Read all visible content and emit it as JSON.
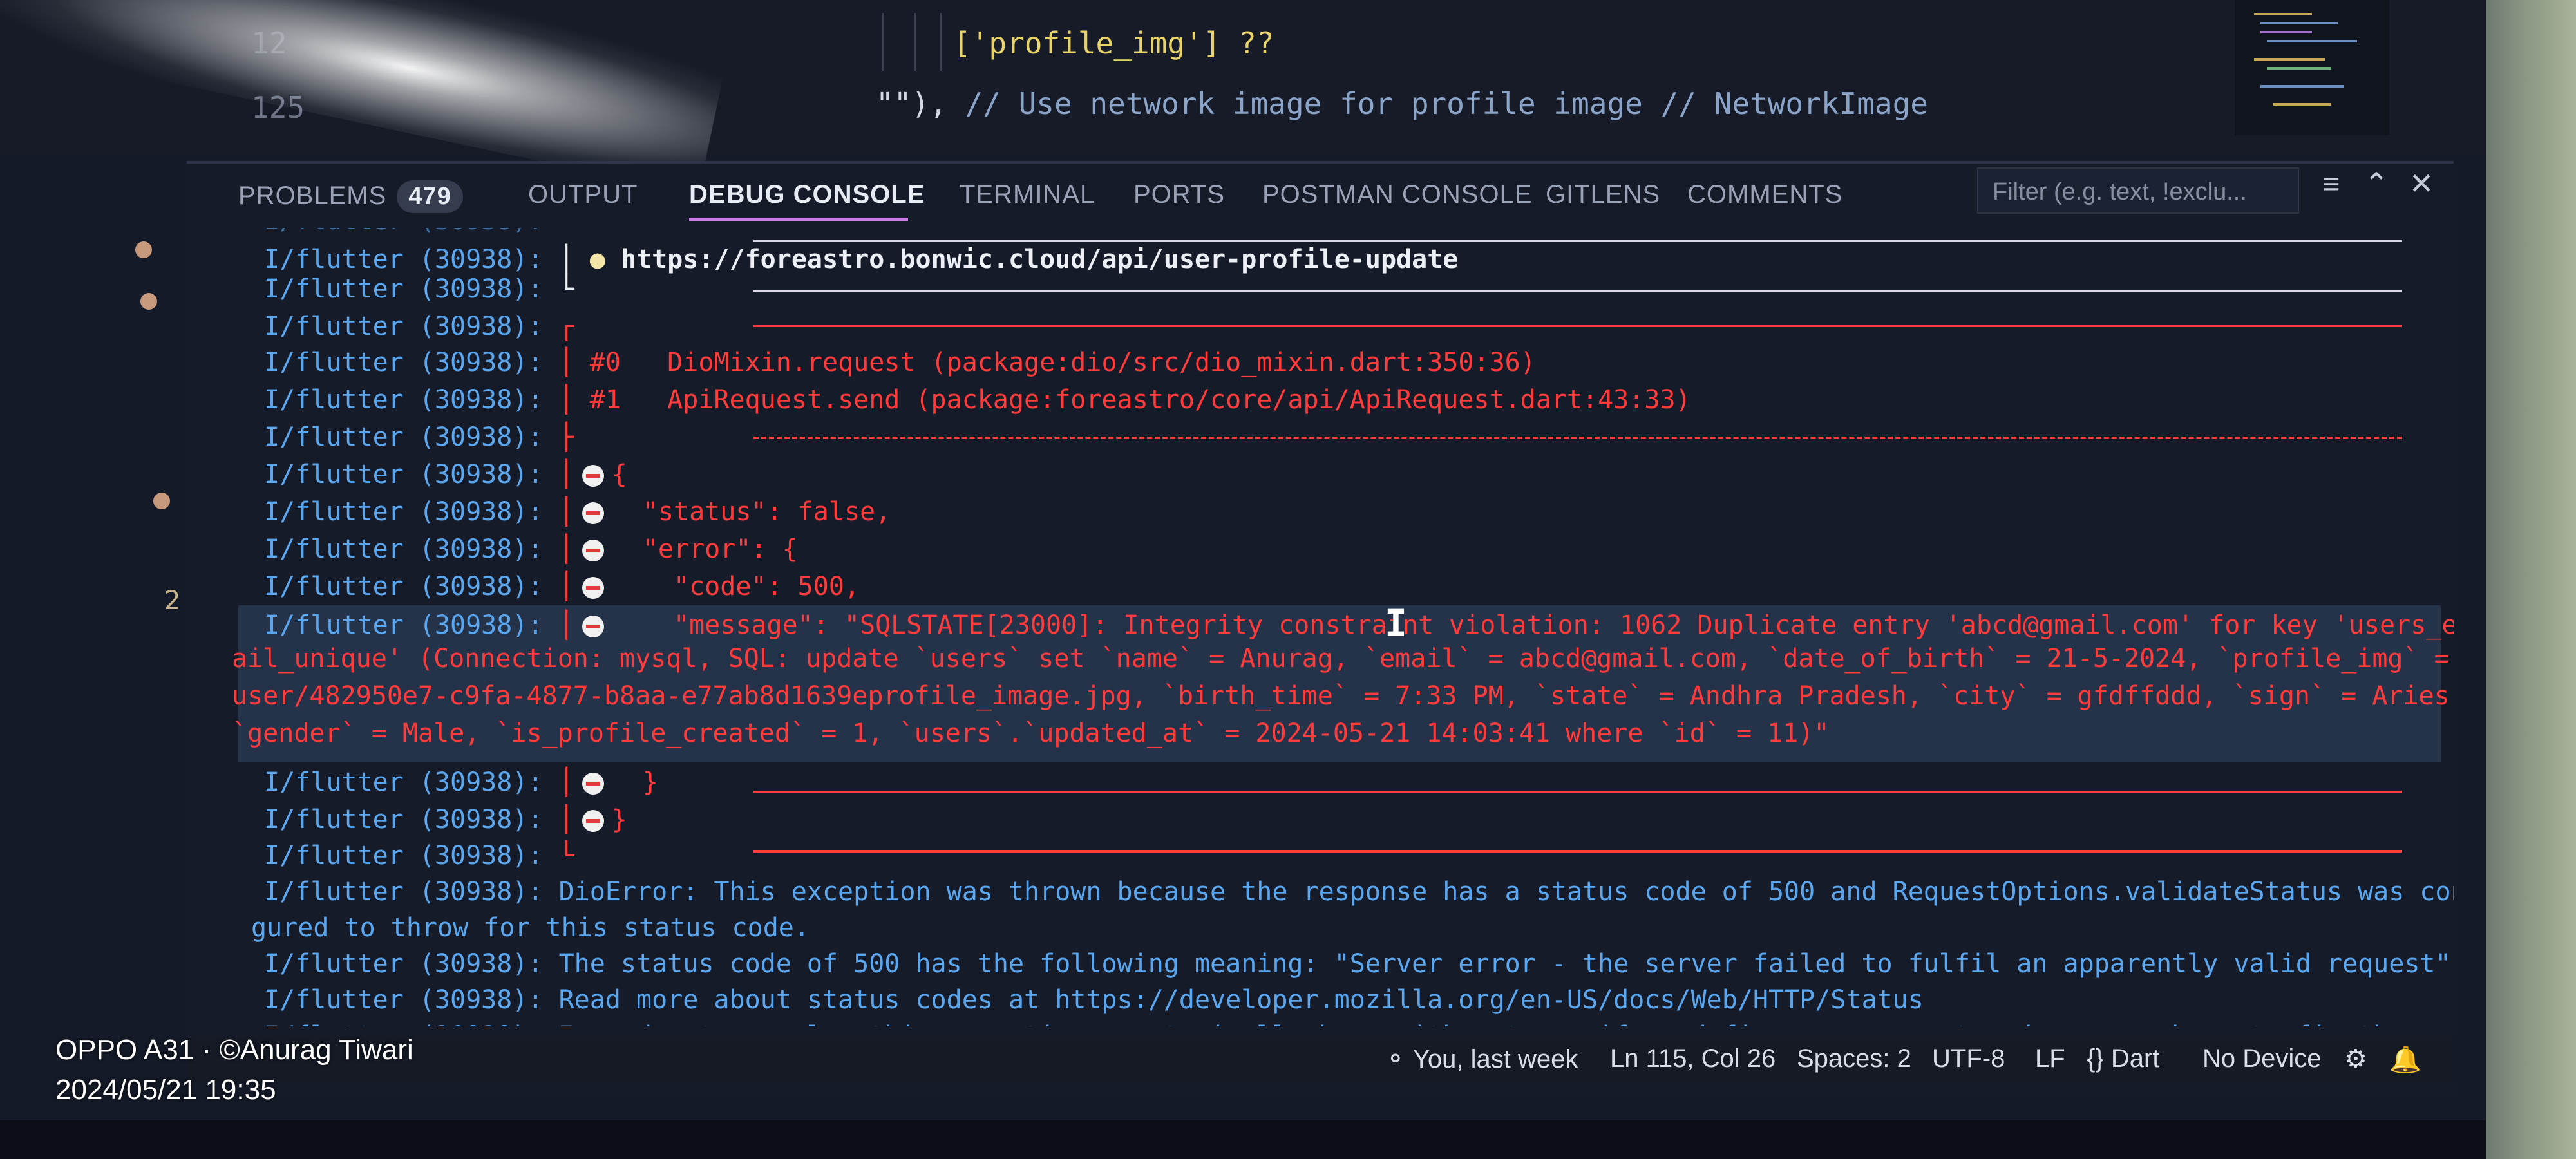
{
  "editor": {
    "line_numbers": [
      "12",
      "125"
    ],
    "code_line_1": "['profile_img'] ??",
    "code_line_2_code": "\"\"), ",
    "code_line_2_comment": "// Use network image for profile image // NetworkImage"
  },
  "sidebar": {
    "badge": "2"
  },
  "panel": {
    "tabs": [
      {
        "label": "PROBLEMS",
        "badge": "479"
      },
      {
        "label": "OUTPUT"
      },
      {
        "label": "DEBUG CONSOLE",
        "active": true
      },
      {
        "label": "TERMINAL"
      },
      {
        "label": "PORTS"
      },
      {
        "label": "POSTMAN CONSOLE"
      },
      {
        "label": "GITLENS"
      },
      {
        "label": "COMMENTS"
      }
    ],
    "filter_placeholder": "Filter (e.g. text, !exclu...",
    "icons": [
      "list-filter-icon",
      "chevron-up-icon",
      "close-icon"
    ]
  },
  "console": {
    "prefix": "I/flutter (30938):",
    "truncated_top": "I/flutter (30938):",
    "url": "https://foreastro.bonwic.cloud/api/user-profile-update",
    "stack_0": "#0   DioMixin.request (package:dio/src/dio_mixin.dart:350:36)",
    "stack_1": "#1   ApiRequest.send (package:foreastro/core/api/ApiRequest.dart:43:33)",
    "json_open": "{",
    "status_line": "\"status\": false,",
    "error_line": "\"error\": {",
    "code_line": "\"code\": 500,",
    "message_line": "\"message\": \"SQLSTATE[23000]: Integrity constraint violation: 1062 Duplicate entry 'abcd@gmail.com' for key 'users_em",
    "message_wrap_1": "ail_unique' (Connection: mysql, SQL: update `users` set `name` = Anurag, `email` = abcd@gmail.com, `date_of_birth` = 21-5-2024, `profile_img` =",
    "message_wrap_2": "user/482950e7-c9fa-4877-b8aa-e77ab8d1639eprofile_image.jpg, `birth_time` = 7:33 PM, `state` = Andhra Pradesh, `city` = gfdffddd, `sign` = Aries,",
    "message_wrap_3": "`gender` = Male, `is_profile_created` = 1, `users`.`updated_at` = 2024-05-21 14:03:41 where `id` = 11)\"",
    "close_inner": "}",
    "close_outer": "}",
    "dio_error": "DioError: This exception was thrown because the response has a status code of 500 and RequestOptions.validateStatus was confi",
    "dio_error_wrap": "gured to throw for this status code.",
    "status_meaning": "The status code of 500 has the following meaning: \"Server error - the server failed to fulfil an apparently valid request\"",
    "read_more": "Read more about status codes at https://developer.mozilla.org/en-US/docs/Web/HTTP/Status",
    "resolve": "In order to resolve this exception you typically have either to verify and fix your request code or you have to fix the serve"
  },
  "statusbar": {
    "blame": "You, last week",
    "position": "Ln 115, Col 26",
    "spaces": "Spaces: 2",
    "encoding": "UTF-8",
    "eol": "LF",
    "language": "{} Dart",
    "device": "No Device"
  },
  "watermark": {
    "line1": "OPPO A31 · ©Anurag Tiwari",
    "line2": "2024/05/21 19:35"
  },
  "colors": {
    "accent_tab": "#c87ee0",
    "error_red": "#ff3b3b",
    "log_blue": "#5aa7f0",
    "selection_bg": "#24324a"
  }
}
